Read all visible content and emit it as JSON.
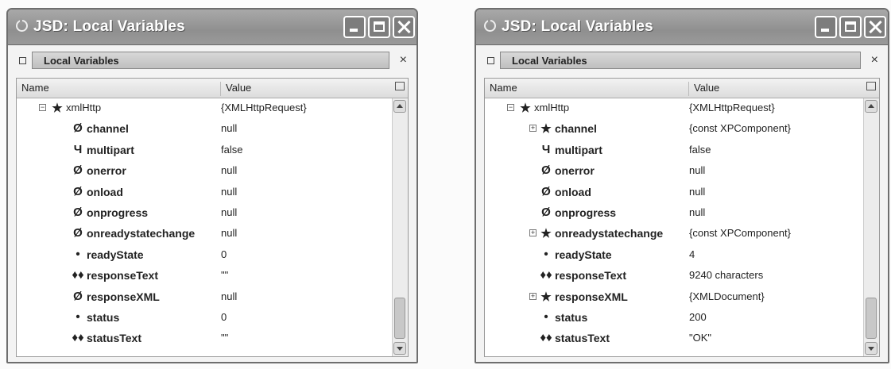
{
  "windows": [
    {
      "title": "JSD: Local Variables",
      "panel_tab": "Local Variables",
      "panel_close": "×",
      "columns": {
        "name": "Name",
        "value": "Value"
      },
      "rows": [
        {
          "name": "xmlHttp",
          "value": "{XMLHttpRequest}",
          "depth": 0,
          "twisty": "−",
          "icon": "★",
          "plain": true
        },
        {
          "name": "channel",
          "value": "null",
          "depth": 1,
          "twisty": "",
          "icon": "Ø"
        },
        {
          "name": "multipart",
          "value": "false",
          "depth": 1,
          "twisty": "",
          "icon": "Ч"
        },
        {
          "name": "onerror",
          "value": "null",
          "depth": 1,
          "twisty": "",
          "icon": "Ø"
        },
        {
          "name": "onload",
          "value": "null",
          "depth": 1,
          "twisty": "",
          "icon": "Ø"
        },
        {
          "name": "onprogress",
          "value": "null",
          "depth": 1,
          "twisty": "",
          "icon": "Ø"
        },
        {
          "name": "onreadystatechange",
          "value": "null",
          "depth": 1,
          "twisty": "",
          "icon": "Ø"
        },
        {
          "name": "readyState",
          "value": "0",
          "depth": 1,
          "twisty": "",
          "icon": "•"
        },
        {
          "name": "responseText",
          "value": "\"\"",
          "depth": 1,
          "twisty": "",
          "icon": "♦♦"
        },
        {
          "name": "responseXML",
          "value": "null",
          "depth": 1,
          "twisty": "",
          "icon": "Ø"
        },
        {
          "name": "status",
          "value": "0",
          "depth": 1,
          "twisty": "",
          "icon": "•"
        },
        {
          "name": "statusText",
          "value": "\"\"",
          "depth": 1,
          "twisty": "",
          "icon": "♦♦"
        }
      ]
    },
    {
      "title": "JSD: Local Variables",
      "panel_tab": "Local Variables",
      "panel_close": "×",
      "columns": {
        "name": "Name",
        "value": "Value"
      },
      "rows": [
        {
          "name": "xmlHttp",
          "value": "{XMLHttpRequest}",
          "depth": 0,
          "twisty": "−",
          "icon": "★",
          "plain": true
        },
        {
          "name": "channel",
          "value": "{const XPComponent}",
          "depth": 1,
          "twisty": "+",
          "icon": "★"
        },
        {
          "name": "multipart",
          "value": "false",
          "depth": 1,
          "twisty": "",
          "icon": "Ч"
        },
        {
          "name": "onerror",
          "value": "null",
          "depth": 1,
          "twisty": "",
          "icon": "Ø"
        },
        {
          "name": "onload",
          "value": "null",
          "depth": 1,
          "twisty": "",
          "icon": "Ø"
        },
        {
          "name": "onprogress",
          "value": "null",
          "depth": 1,
          "twisty": "",
          "icon": "Ø"
        },
        {
          "name": "onreadystatechange",
          "value": "{const XPComponent}",
          "depth": 1,
          "twisty": "+",
          "icon": "★"
        },
        {
          "name": "readyState",
          "value": "4",
          "depth": 1,
          "twisty": "",
          "icon": "•"
        },
        {
          "name": "responseText",
          "value": "9240 characters",
          "depth": 1,
          "twisty": "",
          "icon": "♦♦"
        },
        {
          "name": "responseXML",
          "value": "{XMLDocument}",
          "depth": 1,
          "twisty": "+",
          "icon": "★"
        },
        {
          "name": "status",
          "value": "200",
          "depth": 1,
          "twisty": "",
          "icon": "•"
        },
        {
          "name": "statusText",
          "value": "\"OK\"",
          "depth": 1,
          "twisty": "",
          "icon": "♦♦"
        }
      ]
    }
  ]
}
